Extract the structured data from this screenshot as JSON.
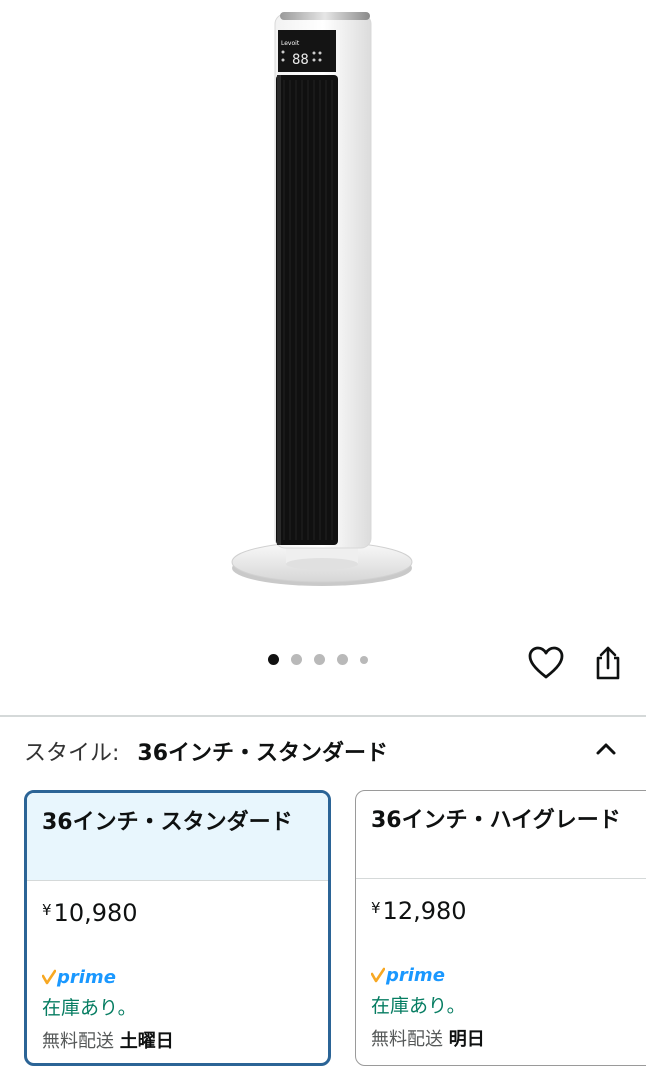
{
  "carousel": {
    "count": 5,
    "active_index": 0
  },
  "actions": {
    "wishlist_icon": "heart-outline-icon",
    "share_icon": "share-icon"
  },
  "style_selector": {
    "label": "スタイル:",
    "selected": "36インチ・スタンダード",
    "toggle_icon": "chevron-up-icon"
  },
  "options": [
    {
      "name": "36インチ・スタンダード",
      "currency": "¥",
      "price": "10,980",
      "prime": "prime",
      "stock": "在庫あり。",
      "delivery_prefix": "無料配送",
      "delivery_day": "土曜日",
      "selected": true
    },
    {
      "name": "36インチ・ハイグレード",
      "currency": "¥",
      "price": "12,980",
      "prime": "prime",
      "stock": "在庫あり。",
      "delivery_prefix": "無料配送",
      "delivery_day": "明日",
      "selected": false
    }
  ],
  "colors": {
    "accent": "#2b6496",
    "selected_bg": "#e8f6fd",
    "stock_green": "#067d62",
    "prime_blue": "#1a98ff",
    "prime_check": "#f7a823"
  }
}
